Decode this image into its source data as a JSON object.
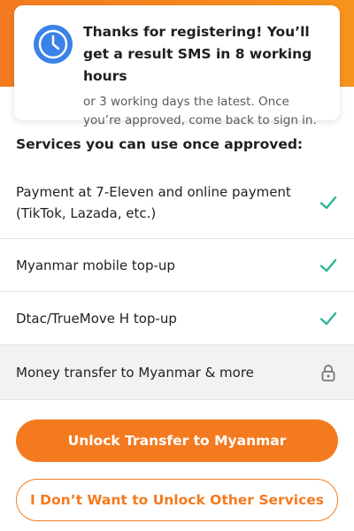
{
  "colors": {
    "accent": "#f47a20",
    "clock_blue": "#3b82e8",
    "check_green": "#2cb59a",
    "lock_gray": "#777777"
  },
  "notice": {
    "icon": "clock-icon",
    "title": "Thanks for registering! You’ll get a result SMS in 8 working hours",
    "subtitle": "or 3 working days the latest. Once you’re approved, come back to sign in."
  },
  "services": {
    "title": "Services you can use once approved:",
    "items": [
      {
        "label": "Payment at 7-Eleven and online payment (TikTok, Lazada, etc.)",
        "status_icon": "check-icon"
      },
      {
        "label": "Myanmar mobile top-up",
        "status_icon": "check-icon"
      },
      {
        "label": "Dtac/TrueMove H top-up",
        "status_icon": "check-icon"
      },
      {
        "label": "Money transfer to Myanmar & more",
        "status_icon": "lock-icon"
      }
    ]
  },
  "buttons": {
    "primary_label": "Unlock Transfer to Myanmar",
    "secondary_label": "I Don’t Want to Unlock Other Services"
  }
}
